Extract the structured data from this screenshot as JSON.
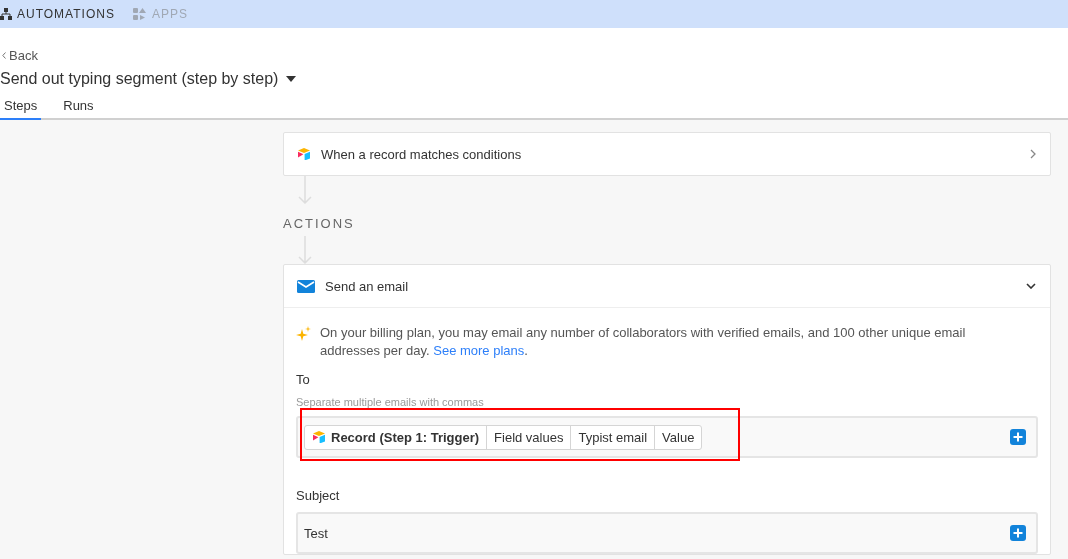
{
  "nav": {
    "items": [
      {
        "label": "AUTOMATIONS",
        "selected": true
      },
      {
        "label": "APPS",
        "selected": false
      }
    ]
  },
  "back": {
    "label": "Back"
  },
  "automation": {
    "title": "Send out typing segment (step by step)"
  },
  "tabs": [
    {
      "label": "Steps",
      "selected": true
    },
    {
      "label": "Runs",
      "selected": false
    }
  ],
  "trigger": {
    "label": "When a record matches conditions",
    "expanded": false
  },
  "actions_heading": "ACTIONS",
  "action": {
    "label": "Send an email",
    "expanded": true,
    "notice": {
      "text": "On your billing plan, you may email any number of collaborators with verified emails, and 100 other unique email addresses per day.",
      "link": "See more plans",
      "after": "."
    },
    "fields": [
      {
        "label": "To",
        "hint": "Separate multiple emails with commas",
        "tokens": [
          {
            "kind": "record",
            "label": "Record (Step 1: Trigger)"
          },
          {
            "kind": "field",
            "label": "Field values"
          },
          {
            "kind": "field",
            "label": "Typist email"
          },
          {
            "kind": "field",
            "label": "Value"
          }
        ]
      },
      {
        "label": "Subject",
        "value": "Test"
      }
    ]
  }
}
